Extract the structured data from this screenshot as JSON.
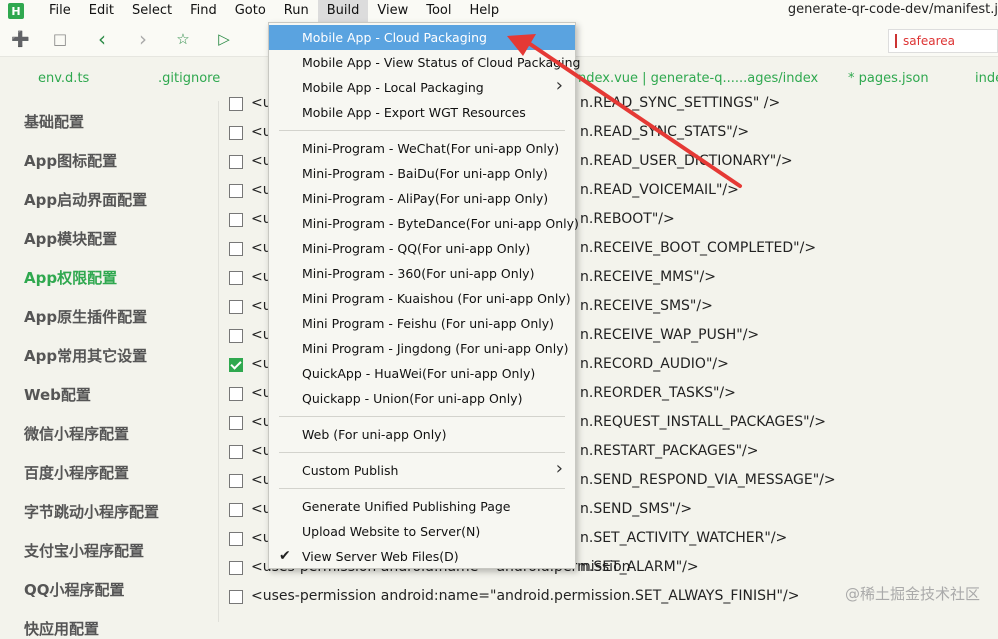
{
  "app": {
    "logo": "H",
    "window_title": "generate-qr-code-dev/manifest.j"
  },
  "menubar": [
    "File",
    "Edit",
    "Select",
    "Find",
    "Goto",
    "Run",
    "Build",
    "View",
    "Tool",
    "Help"
  ],
  "menubar_active": "Build",
  "toolbar": {
    "icons": [
      "new-file-icon",
      "save-icon",
      "back-icon",
      "forward-icon",
      "star-icon",
      "run-icon"
    ],
    "search_value": "safearea"
  },
  "tabs": [
    "env.d.ts",
    ".gitignore",
    "ndex.vue | generate-q......ages/index",
    "* pages.json",
    "inde"
  ],
  "sidebar": {
    "items": [
      "基础配置",
      "App图标配置",
      "App启动界面配置",
      "App模块配置",
      "App权限配置",
      "App原生插件配置",
      "App常用其它设置",
      "Web配置",
      "微信小程序配置",
      "百度小程序配置",
      "字节跳动小程序配置",
      "支付宝小程序配置",
      "QQ小程序配置",
      "快应用配置"
    ],
    "active": "App权限配置"
  },
  "editor": {
    "rows": [
      {
        "left": "<u",
        "right": "n.READ_SYNC_SETTINGS\" />",
        "checked": false
      },
      {
        "left": "<u",
        "right": "n.READ_SYNC_STATS\"/>",
        "checked": false
      },
      {
        "left": "<u",
        "right": "n.READ_USER_DICTIONARY\"/>",
        "checked": false
      },
      {
        "left": "<u",
        "right": "n.READ_VOICEMAIL\"/>",
        "checked": false
      },
      {
        "left": "<u",
        "right": "n.REBOOT\"/>",
        "checked": false
      },
      {
        "left": "<u",
        "right": "n.RECEIVE_BOOT_COMPLETED\"/>",
        "checked": false
      },
      {
        "left": "<u",
        "right": "n.RECEIVE_MMS\"/>",
        "checked": false
      },
      {
        "left": "<u",
        "right": "n.RECEIVE_SMS\"/>",
        "checked": false
      },
      {
        "left": "<u",
        "right": "n.RECEIVE_WAP_PUSH\"/>",
        "checked": false
      },
      {
        "left": "<u",
        "right": "n.RECORD_AUDIO\"/>",
        "checked": true
      },
      {
        "left": "<u",
        "right": "n.REORDER_TASKS\"/>",
        "checked": false
      },
      {
        "left": "<u",
        "right": "n.REQUEST_INSTALL_PACKAGES\"/>",
        "checked": false
      },
      {
        "left": "<u",
        "right": "n.RESTART_PACKAGES\"/>",
        "checked": false
      },
      {
        "left": "<u",
        "right": "n.SEND_RESPOND_VIA_MESSAGE\"/>",
        "checked": false
      },
      {
        "left": "<u",
        "right": "n.SEND_SMS\"/>",
        "checked": false
      },
      {
        "left": "<u",
        "right": "n.SET_ACTIVITY_WATCHER\"/>",
        "checked": false
      },
      {
        "left": "<uses-permission android:name=\"android.permission",
        "right": "n.SET_ALARM\"/>",
        "checked": false
      },
      {
        "full": "<uses-permission android:name=\"android.permission.SET_ALWAYS_FINISH\"/>",
        "checked": false
      }
    ]
  },
  "build_menu": {
    "groups": [
      [
        {
          "label": "Mobile App - Cloud Packaging",
          "highlighted": true
        },
        {
          "label": "Mobile App - View Status of Cloud Packaging"
        },
        {
          "label": "Mobile App - Local Packaging",
          "submenu": true
        },
        {
          "label": "Mobile App - Export WGT Resources"
        }
      ],
      [
        {
          "label": "Mini-Program - WeChat(For uni-app Only)"
        },
        {
          "label": "Mini-Program - BaiDu(For uni-app Only)"
        },
        {
          "label": "Mini-Program - AliPay(For uni-app Only)"
        },
        {
          "label": "Mini-Program - ByteDance(For uni-app Only)"
        },
        {
          "label": "Mini-Program - QQ(For uni-app Only)"
        },
        {
          "label": "Mini-Program - 360(For uni-app Only)"
        },
        {
          "label": "Mini Program - Kuaishou (For uni-app Only)"
        },
        {
          "label": "Mini Program - Feishu (For uni-app Only)"
        },
        {
          "label": "Mini Program - Jingdong (For uni-app Only)"
        },
        {
          "label": "QuickApp - HuaWei(For uni-app Only)"
        },
        {
          "label": "Quickapp - Union(For uni-app Only)"
        }
      ],
      [
        {
          "label": "Web (For uni-app Only)"
        }
      ],
      [
        {
          "label": "Custom Publish",
          "submenu": true
        }
      ],
      [
        {
          "label": "Generate Unified Publishing Page"
        },
        {
          "label": "Upload Website to Server(N)"
        },
        {
          "label": "View Server Web Files(D)",
          "checked": true
        }
      ]
    ]
  },
  "annotation": {
    "arrow_color": "#e53935"
  },
  "watermark": "@稀土掘金技术社区",
  "colors": {
    "accent": "#2fa84f",
    "highlight": "#5aa3e0"
  }
}
